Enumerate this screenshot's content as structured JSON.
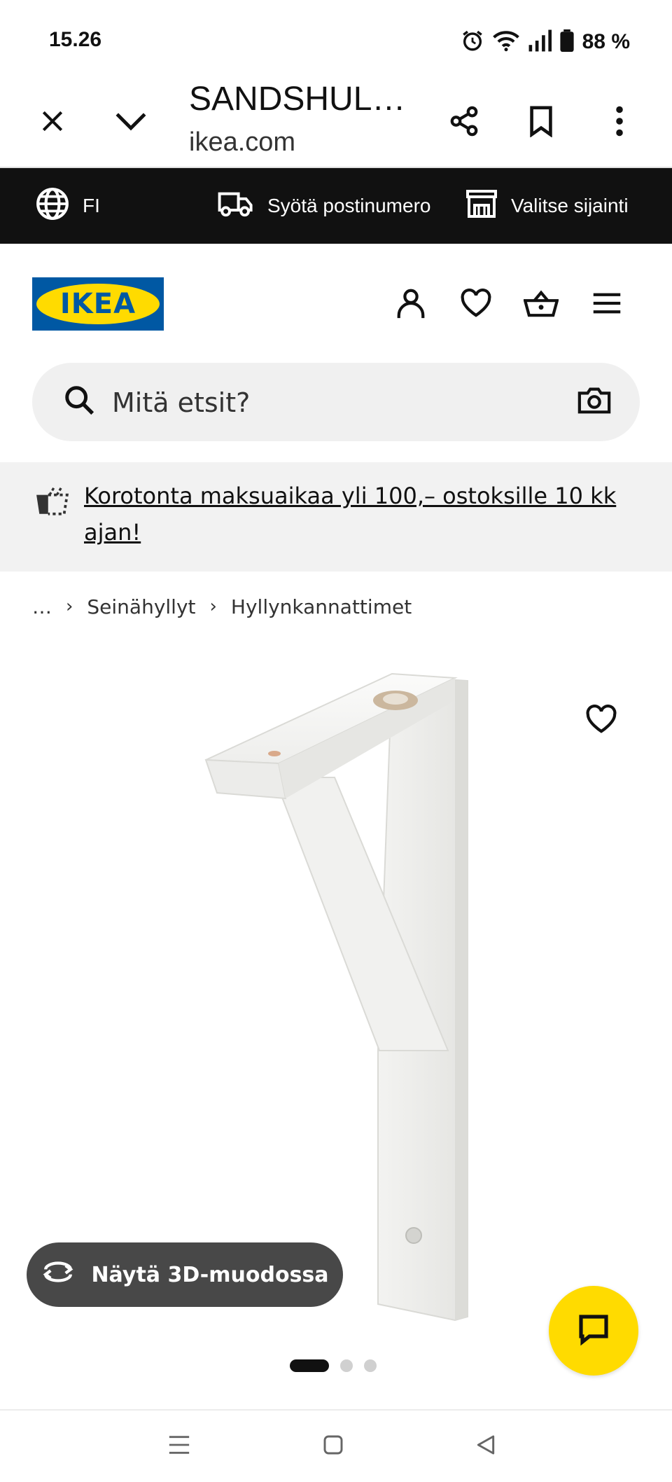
{
  "status_bar": {
    "time": "15.26",
    "battery_text": "88 %",
    "icons": [
      "alarm-icon",
      "wifi-icon",
      "signal-icon",
      "battery-icon"
    ]
  },
  "browser": {
    "page_title": "SANDSHUL…",
    "domain": "ikea.com",
    "icons": [
      "close-icon",
      "chevron-down-icon",
      "share-icon",
      "bookmark-icon",
      "more-vert-icon"
    ]
  },
  "utility_bar": {
    "language": "FI",
    "postcode_label": "Syötä postinumero",
    "location_label": "Valitse sijainti"
  },
  "header": {
    "logo_text": "IKEA",
    "icons": [
      "profile-icon",
      "heart-icon",
      "basket-icon",
      "menu-icon"
    ]
  },
  "search": {
    "placeholder": "Mitä etsit?"
  },
  "promo": {
    "text": "Korotonta maksuaikaa yli 100,– ostoksille 10 kk ajan!"
  },
  "breadcrumb": {
    "items": [
      "…",
      "Seinähyllyt",
      "Hyllynkannattimet"
    ]
  },
  "product": {
    "view_3d_label": "Näytä 3D-muodossa",
    "carousel": {
      "count": 3,
      "active_index": 0
    }
  },
  "colors": {
    "ikea_blue": "#0058a3",
    "ikea_yellow": "#ffdb00",
    "utility_bar_bg": "#111111",
    "button_3d_bg": "#484848"
  }
}
